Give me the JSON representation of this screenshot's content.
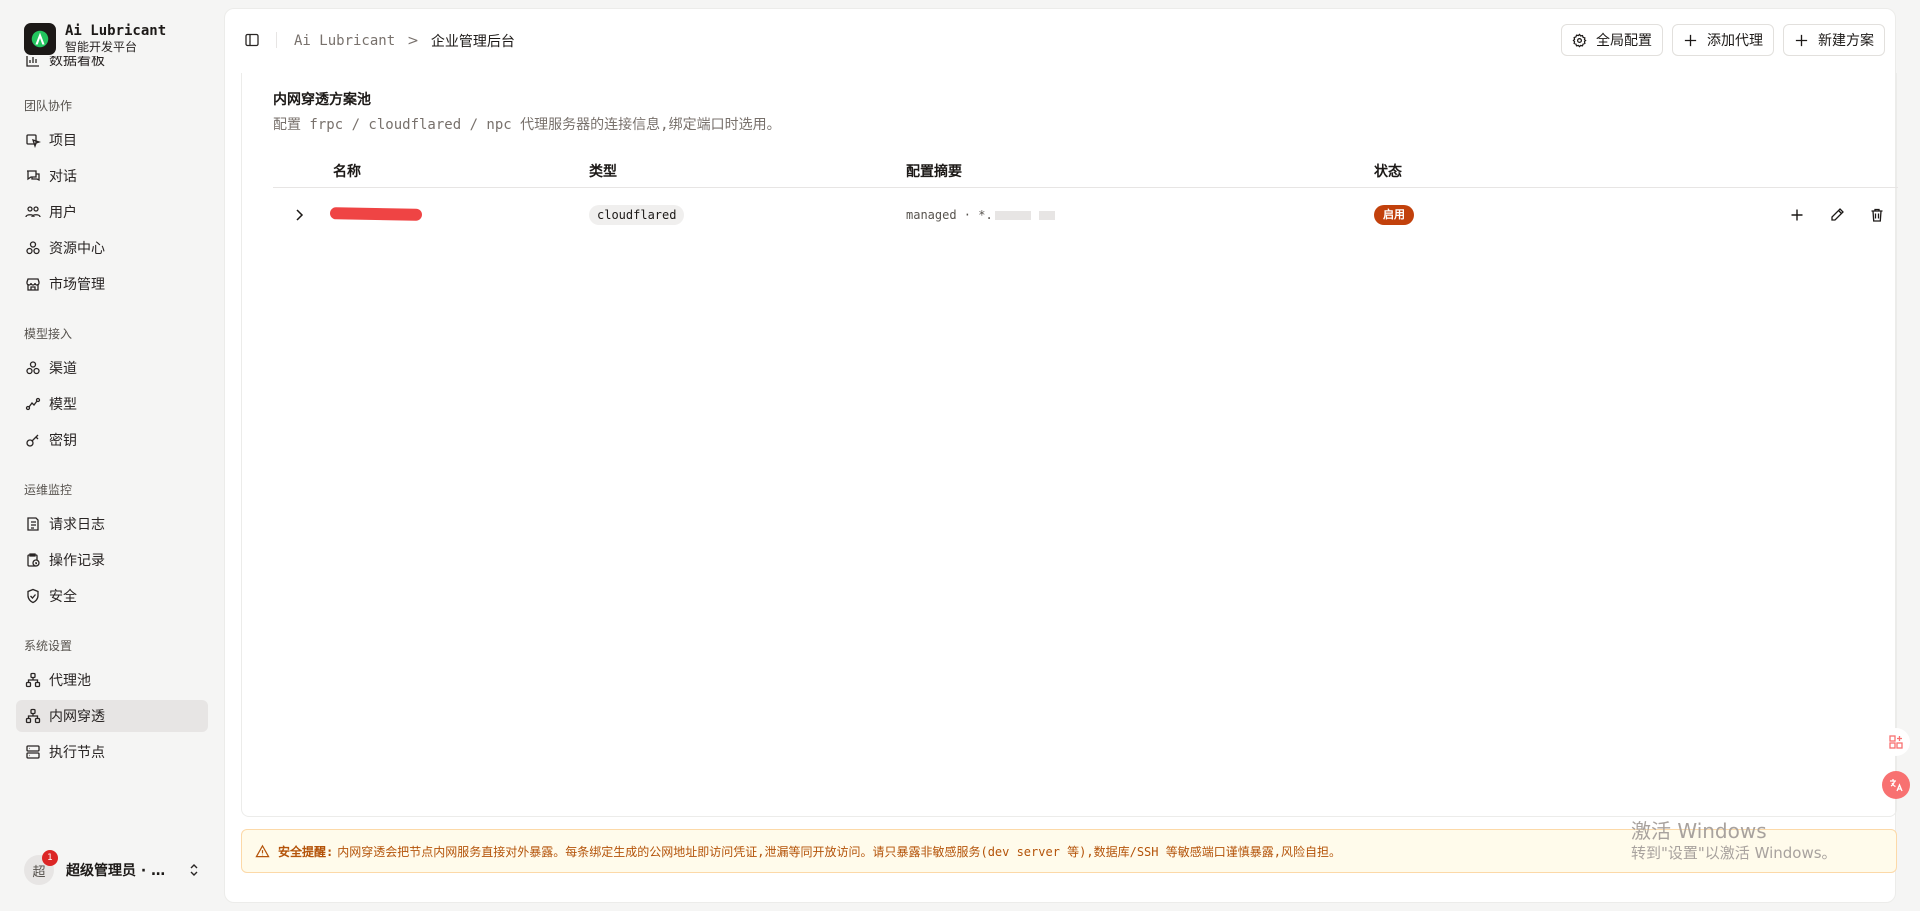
{
  "brand": {
    "title": "Ai Lubricant",
    "subtitle": "智能开发平台"
  },
  "sidebar": {
    "top_items": [
      {
        "label": "数据看板",
        "icon": "bar-chart-icon"
      }
    ],
    "sections": [
      {
        "title": "团队协作",
        "items": [
          {
            "label": "项目",
            "icon": "project-icon"
          },
          {
            "label": "对话",
            "icon": "chat-icon"
          },
          {
            "label": "用户",
            "icon": "users-icon"
          },
          {
            "label": "资源中心",
            "icon": "resources-icon"
          },
          {
            "label": "市场管理",
            "icon": "store-icon"
          }
        ]
      },
      {
        "title": "模型接入",
        "items": [
          {
            "label": "渠道",
            "icon": "channel-icon"
          },
          {
            "label": "模型",
            "icon": "model-icon"
          },
          {
            "label": "密钥",
            "icon": "key-icon"
          }
        ]
      },
      {
        "title": "运维监控",
        "items": [
          {
            "label": "请求日志",
            "icon": "log-icon"
          },
          {
            "label": "操作记录",
            "icon": "history-icon"
          },
          {
            "label": "安全",
            "icon": "shield-icon"
          }
        ]
      },
      {
        "title": "系统设置",
        "items": [
          {
            "label": "代理池",
            "icon": "network-icon"
          },
          {
            "label": "内网穿透",
            "icon": "network-icon",
            "active": true
          },
          {
            "label": "执行节点",
            "icon": "server-icon"
          }
        ]
      }
    ],
    "user": {
      "avatar": "超",
      "badge": "1",
      "name": "超级管理员 · …"
    }
  },
  "header": {
    "breadcrumb_root": "Ai Lubricant",
    "breadcrumb_sep": ">",
    "breadcrumb_current": "企业管理后台",
    "buttons": {
      "global": "全局配置",
      "add_proxy": "添加代理",
      "new_plan": "新建方案"
    }
  },
  "card": {
    "title": "内网穿透方案池",
    "description": "配置 frpc / cloudflared / npc 代理服务器的连接信息,绑定端口时选用。",
    "columns": {
      "name": "名称",
      "type": "类型",
      "summary": "配置摘要",
      "status": "状态"
    },
    "rows": [
      {
        "type": "cloudflared",
        "summary": "managed · *.",
        "status": "启用"
      }
    ]
  },
  "warning": {
    "label": "安全提醒:",
    "text": "内网穿透会把节点内网服务直接对外暴露。每条绑定生成的公网地址即访问凭证,泄漏等同开放访问。请只暴露非敏感服务(dev server 等),数据库/SSH 等敏感端口谨慎暴露,风险自担。"
  },
  "watermark": {
    "line1": "激活 Windows",
    "line2": "转到\"设置\"以激活 Windows。"
  },
  "colors": {
    "status_active": "#c2410c",
    "warning_text": "#b45309",
    "redacted": "#ef4444"
  }
}
